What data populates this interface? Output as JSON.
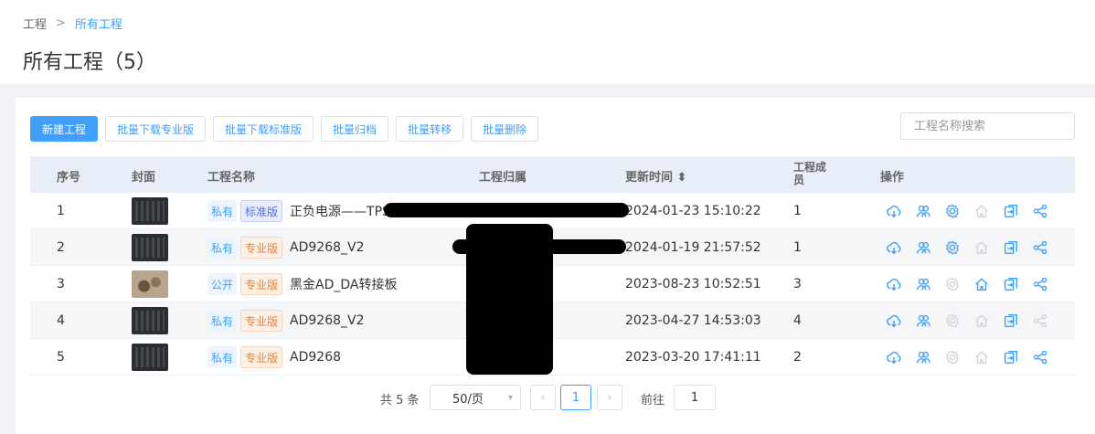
{
  "breadcrumb": {
    "root": "工程",
    "separator": ">",
    "current": "所有工程"
  },
  "page_title": "所有工程（5）",
  "toolbar": {
    "new_project": "新建工程",
    "batch_download_pro": "批量下载专业版",
    "batch_download_std": "批量下载标准版",
    "batch_archive": "批量归档",
    "batch_transfer": "批量转移",
    "batch_delete": "批量删除"
  },
  "search": {
    "placeholder": "工程名称搜索",
    "value": ""
  },
  "table": {
    "headers": {
      "index": "序号",
      "cover": "封面",
      "name": "工程名称",
      "owner": "工程归属",
      "updated": "更新时间 ⬍",
      "members": "工程成员",
      "actions": "操作"
    },
    "rows": [
      {
        "index": "1",
        "visibility": "私有",
        "edition": "标准版",
        "name": "正负电源——TPS5430",
        "updated": "2024-01-23 15:10:22",
        "members": "1"
      },
      {
        "index": "2",
        "visibility": "私有",
        "edition": "专业版",
        "name": "AD9268_V2",
        "updated": "2024-01-19 21:57:52",
        "members": "1"
      },
      {
        "index": "3",
        "visibility": "公开",
        "edition": "专业版",
        "name": "黑金AD_DA转接板",
        "updated": "2023-08-23 10:52:51",
        "members": "3"
      },
      {
        "index": "4",
        "visibility": "私有",
        "edition": "专业版",
        "name": "AD9268_V2",
        "updated": "2023-04-27 14:53:03",
        "members": "4"
      },
      {
        "index": "5",
        "visibility": "私有",
        "edition": "专业版",
        "name": "AD9268",
        "updated": "2023-03-20 17:41:11",
        "members": "2"
      }
    ]
  },
  "pagination": {
    "total": "共 5 条",
    "page_size": "50/页",
    "prev": "‹",
    "current_page": "1",
    "next": "›",
    "goto_label": "前往",
    "goto_value": "1"
  },
  "colors": {
    "accent": "#409eff",
    "pro_tag": "#e6813d",
    "std_tag": "#5a6bdb",
    "header_bg": "#e8eef8"
  }
}
